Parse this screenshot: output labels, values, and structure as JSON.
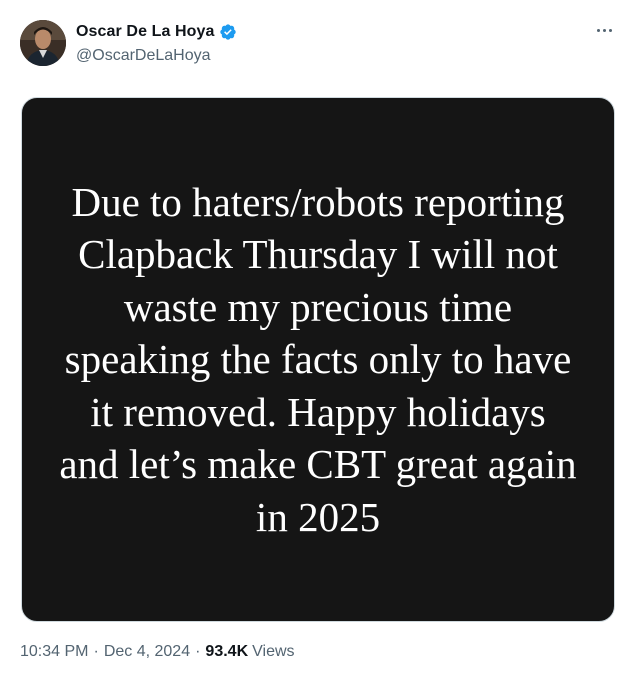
{
  "author": {
    "display_name": "Oscar De La Hoya",
    "handle": "@OscarDeLaHoya",
    "verified": true,
    "verified_icon": "verified-badge-icon",
    "verified_color": "#1d9bf0"
  },
  "more_icon": "more-horizontal-icon",
  "post": {
    "image_text": "Due to haters/robots reporting Clapback Thursday I will not waste my precious time speaking the facts only to have it removed. Happy holidays and let’s make CBT great again in 2025",
    "image_background": "#151515"
  },
  "meta": {
    "time": "10:34 PM",
    "separator": "·",
    "date": "Dec 4, 2024",
    "views_count": "93.4K",
    "views_label": "Views"
  }
}
